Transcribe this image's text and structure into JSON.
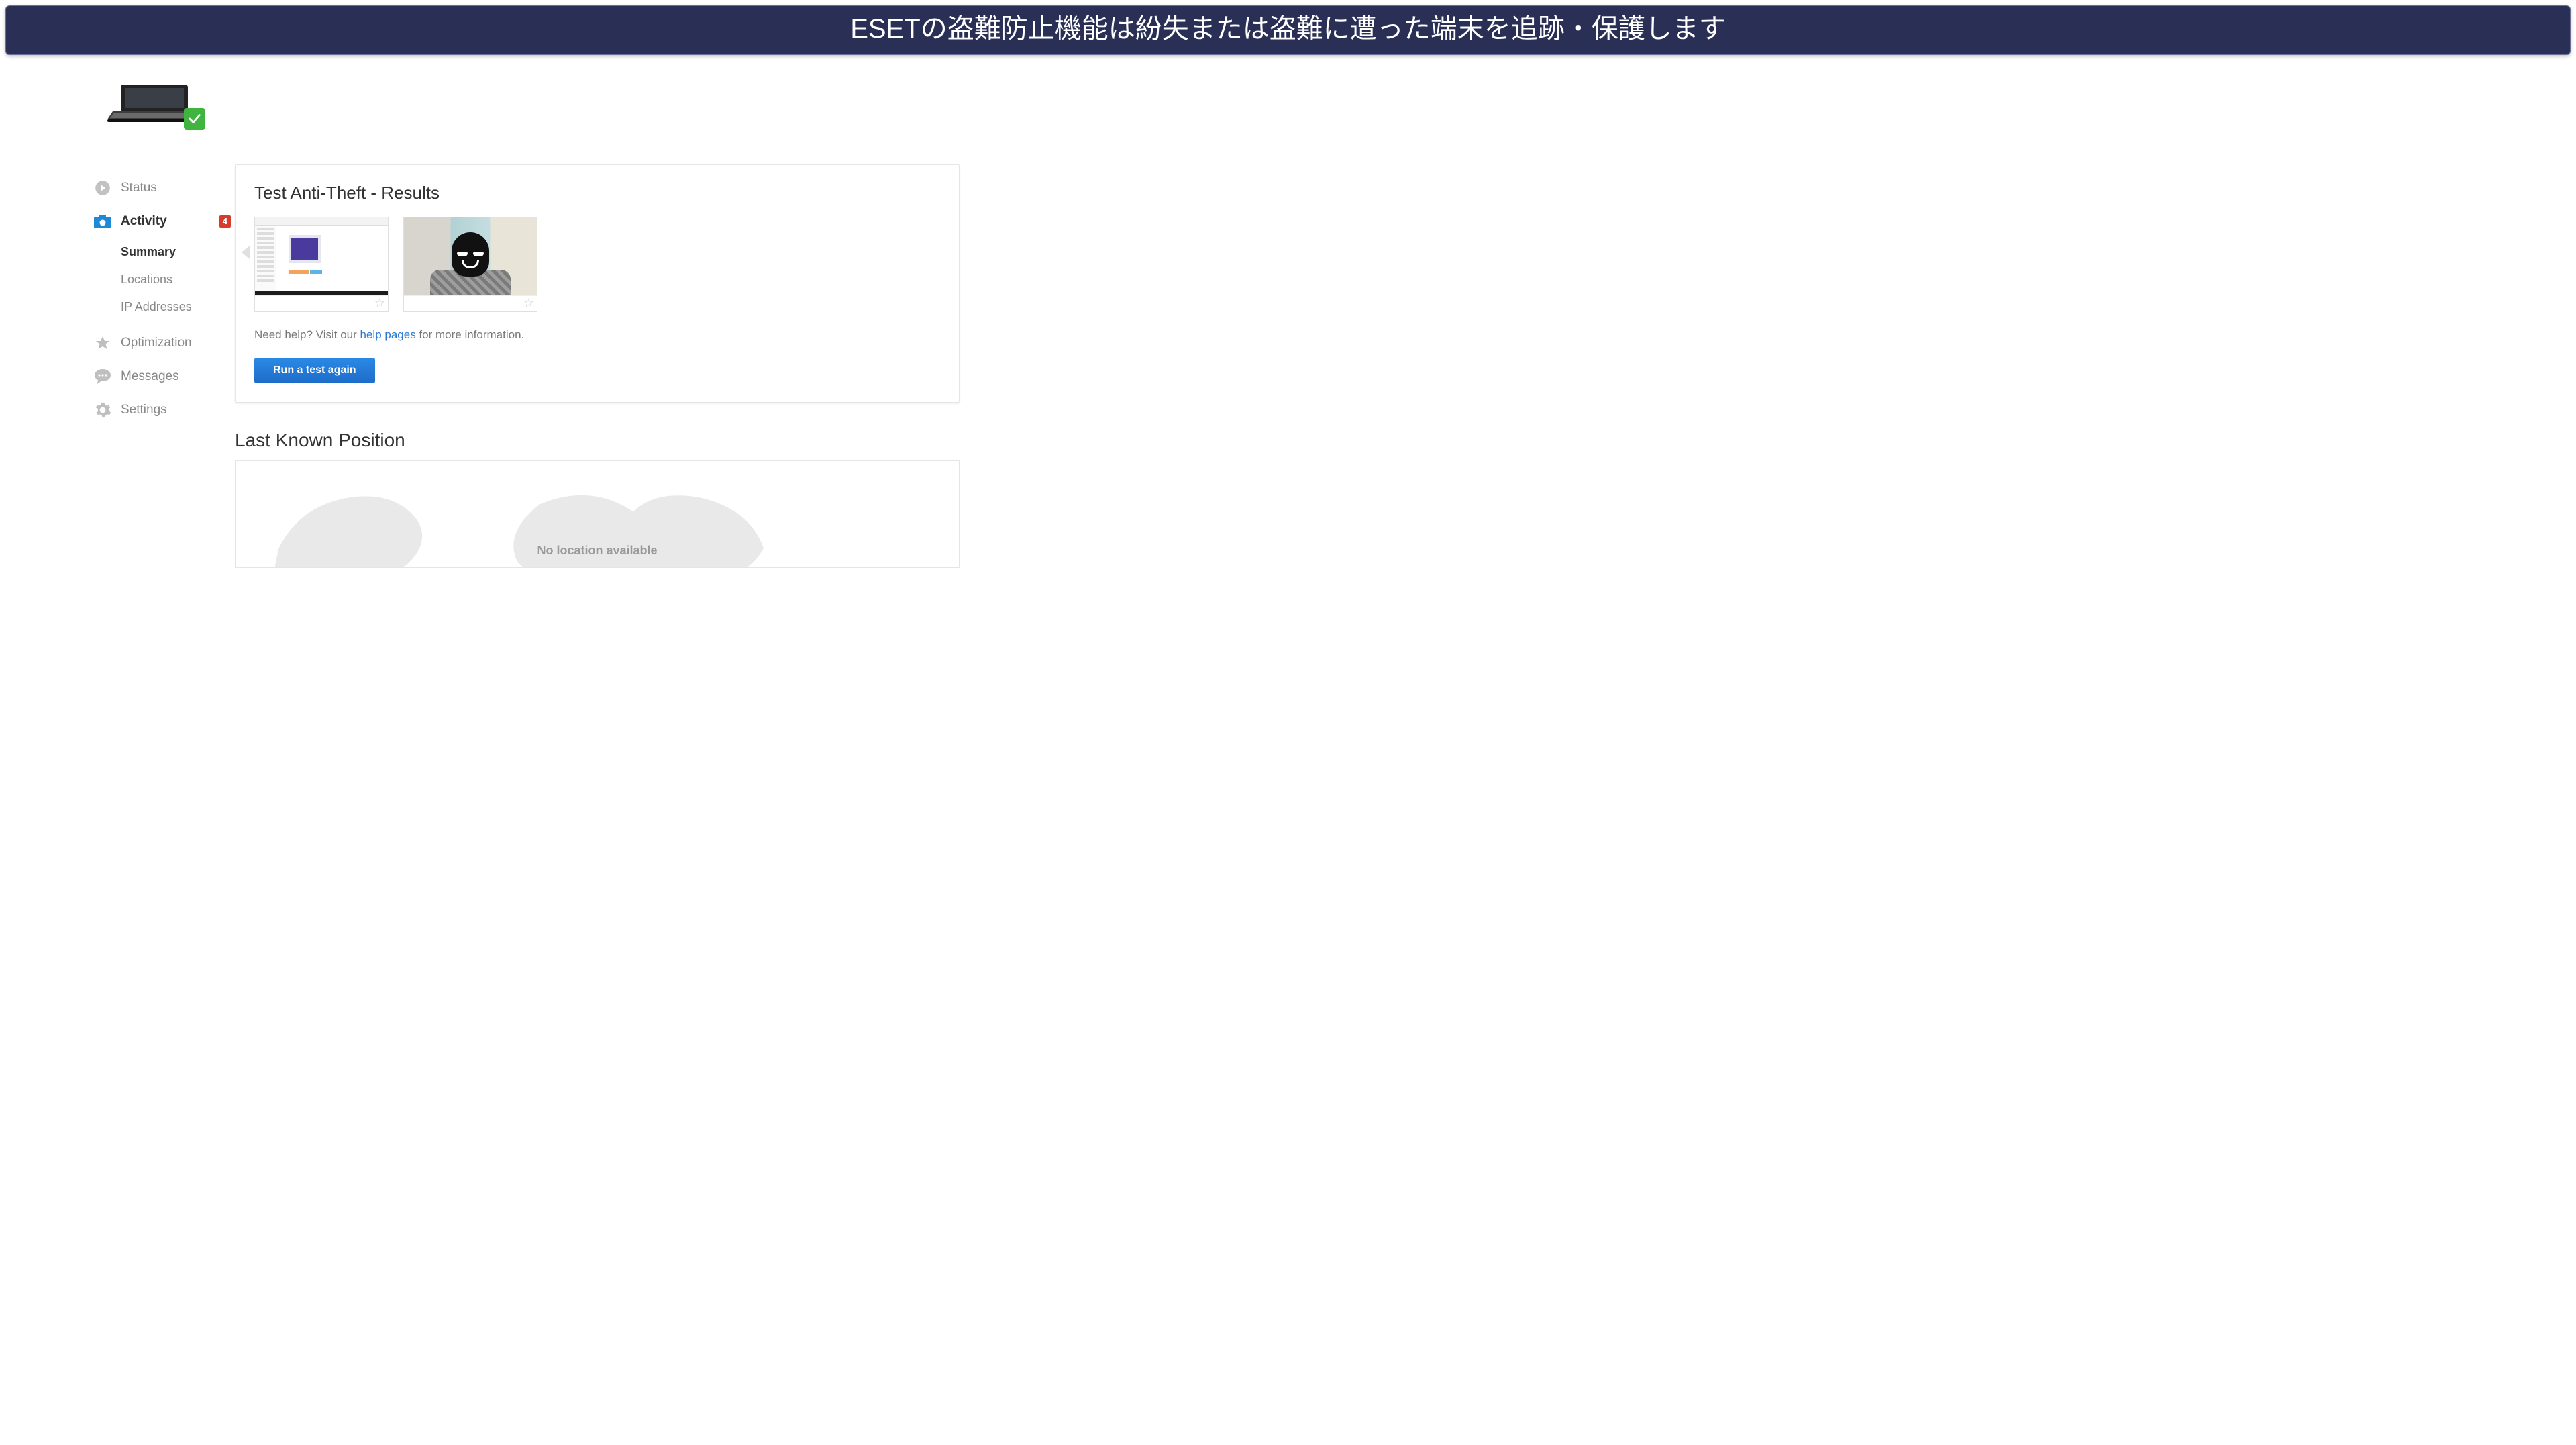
{
  "banner": {
    "text": "ESETの盗難防止機能は紛失または盗難に遭った端末を追跡・保護します"
  },
  "sidebar": {
    "items": [
      {
        "key": "status",
        "label": "Status"
      },
      {
        "key": "activity",
        "label": "Activity",
        "badge": "4"
      },
      {
        "key": "optimization",
        "label": "Optimization"
      },
      {
        "key": "messages",
        "label": "Messages"
      },
      {
        "key": "settings",
        "label": "Settings"
      }
    ],
    "activity_submenu": [
      {
        "key": "summary",
        "label": "Summary"
      },
      {
        "key": "locations",
        "label": "Locations"
      },
      {
        "key": "ip-addresses",
        "label": "IP Addresses"
      }
    ]
  },
  "results": {
    "title": "Test Anti-Theft - Results",
    "help_prefix": "Need help? Visit our ",
    "help_link_text": "help pages",
    "help_suffix": " for more information.",
    "run_button": "Run a test again"
  },
  "position": {
    "title": "Last Known Position",
    "empty_state": "No location available"
  }
}
